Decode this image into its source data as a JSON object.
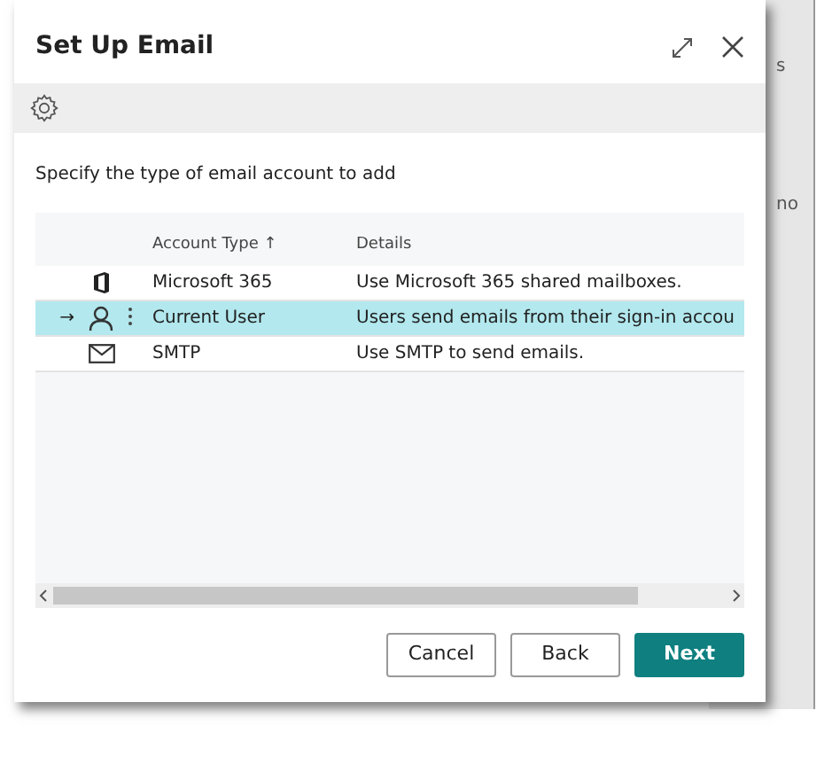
{
  "window": {
    "title": "Set Up Email"
  },
  "instruction": "Specify the type of email account to add",
  "table": {
    "columns": [
      {
        "label": "Account Type",
        "sort": "↑"
      },
      {
        "label": "Details"
      }
    ],
    "rows": [
      {
        "kind": "office",
        "account_type": "Microsoft 365",
        "details": "Use Microsoft 365 shared mailboxes.",
        "selected": false
      },
      {
        "kind": "user",
        "pointer": "→",
        "account_type": "Current User",
        "details": "Users send emails from their sign-in accou",
        "selected": true
      },
      {
        "kind": "mail",
        "account_type": "SMTP",
        "details": "Use SMTP to send emails.",
        "selected": false
      }
    ]
  },
  "buttons": [
    {
      "label": "Cancel",
      "primary": false
    },
    {
      "label": "Back",
      "primary": false
    },
    {
      "label": "Next",
      "primary": true
    }
  ],
  "background_texts": [
    "s",
    "no"
  ]
}
